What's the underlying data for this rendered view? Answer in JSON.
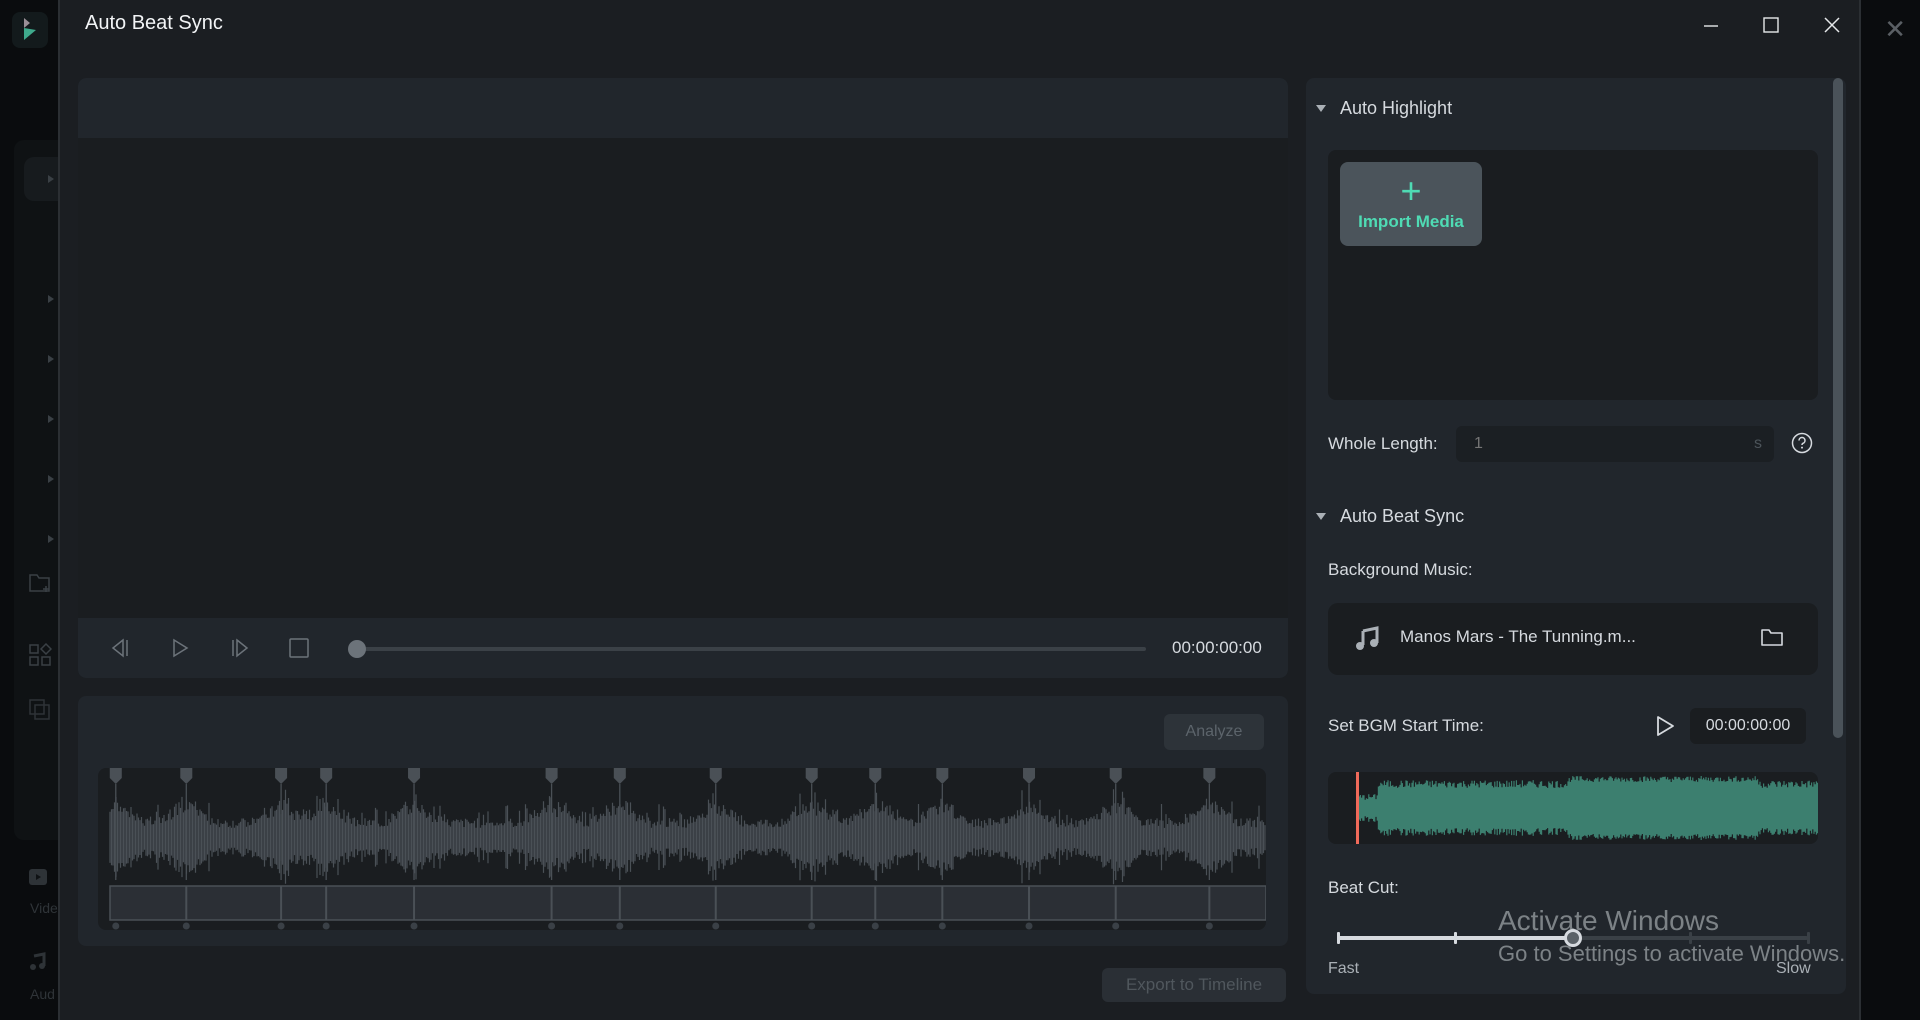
{
  "background_app": {
    "sidebar_labels": [
      "Vide",
      "Aud"
    ],
    "top_strip_colors": {
      "base": "#e6e6ea",
      "accent": "#b42fc6"
    }
  },
  "dialog": {
    "title": "Auto Beat Sync",
    "window_controls": {
      "minimize": "minimize-icon",
      "maximize": "maximize-icon",
      "close": "close-icon"
    }
  },
  "player": {
    "controls": [
      "previous-frame-icon",
      "play-icon",
      "next-frame-icon",
      "stop-icon"
    ],
    "progress": 0,
    "time": "00:00:00:00"
  },
  "beat_analysis": {
    "analyze_label": "Analyze",
    "analyze_enabled": false,
    "beat_markers_relative": [
      0.005,
      0.066,
      0.148,
      0.187,
      0.263,
      0.382,
      0.441,
      0.524,
      0.607,
      0.662,
      0.72,
      0.795,
      0.87,
      0.951
    ]
  },
  "export_label": "Export to Timeline",
  "settings": {
    "auto_highlight": {
      "title": "Auto Highlight",
      "import_media_label": "Import Media",
      "whole_length_label": "Whole Length:",
      "whole_length_placeholder": "1",
      "whole_length_unit": "s"
    },
    "auto_beat_sync": {
      "title": "Auto Beat Sync",
      "background_music_label": "Background Music:",
      "music_file": "Manos Mars - The Tunning.m...",
      "bgm_start_label": "Set BGM Start Time:",
      "bgm_start_time": "00:00:00:00",
      "bgm_waveform_color": "#3c7f6f",
      "bgm_playhead_color": "#f06a5a",
      "beat_cut_label": "Beat Cut:",
      "beat_cut": {
        "min_label": "Fast",
        "max_label": "Slow",
        "steps": 5,
        "value_step": 3
      }
    }
  },
  "watermark": {
    "line1": "Activate Windows",
    "line2": "Go to Settings to activate Windows."
  },
  "colors": {
    "accent": "#4fdbb4",
    "dialog_bg": "#1b1e22",
    "panel_bg": "#21262c"
  }
}
